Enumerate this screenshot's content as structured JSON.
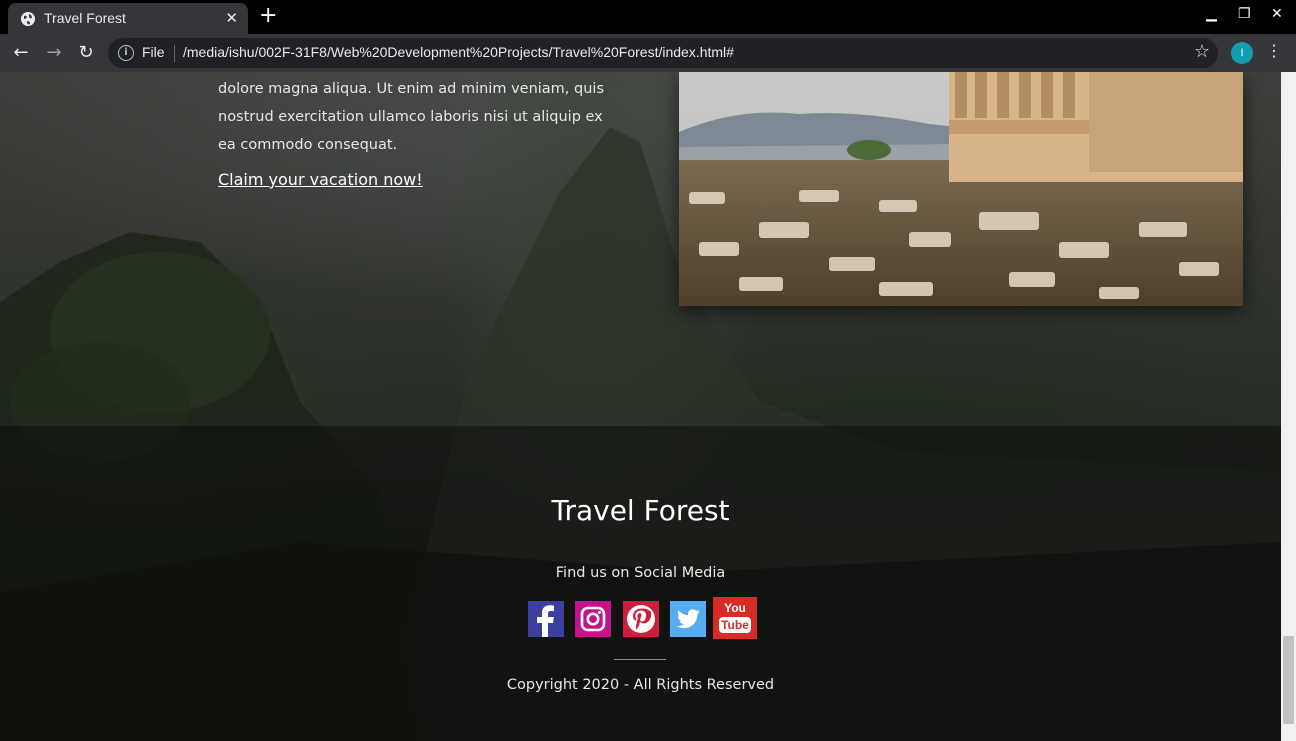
{
  "browser": {
    "tab_title": "Travel Forest",
    "tab_close": "✕",
    "new_tab": "+",
    "url_scheme": "File",
    "url": "/media/ishu/002F-31F8/Web%20Development%20Projects/Travel%20Forest/index.html#",
    "profile_initial": "I",
    "back_icon": "←",
    "forward_icon": "→",
    "reload_icon": "↻",
    "info_icon": "i",
    "star_icon": "☆",
    "menu_icon": "⋮",
    "minimize_icon": "▁",
    "restore_icon": "❐",
    "close_icon": "✕"
  },
  "content": {
    "paragraph": "dolore magna aliqua. Ut enim ad minim veniam, quis nostrud exercitation ullamco laboris nisi ut aliquip ex ea commodo consequat.",
    "cta": "Claim your vacation now!"
  },
  "footer": {
    "title": "Travel Forest",
    "social_heading": "Find us on Social Media",
    "social": [
      {
        "name": "facebook-icon",
        "color": "#3b3f9e"
      },
      {
        "name": "instagram-icon",
        "color": "#c1148c"
      },
      {
        "name": "pinterest-icon",
        "color": "#cb1f3e"
      },
      {
        "name": "twitter-icon",
        "color": "#55acee"
      },
      {
        "name": "youtube-icon",
        "color": "#d92b25",
        "label_top": "You",
        "label_bottom": "Tube"
      }
    ],
    "copyright": "Copyright 2020 - All Rights Reserved"
  }
}
